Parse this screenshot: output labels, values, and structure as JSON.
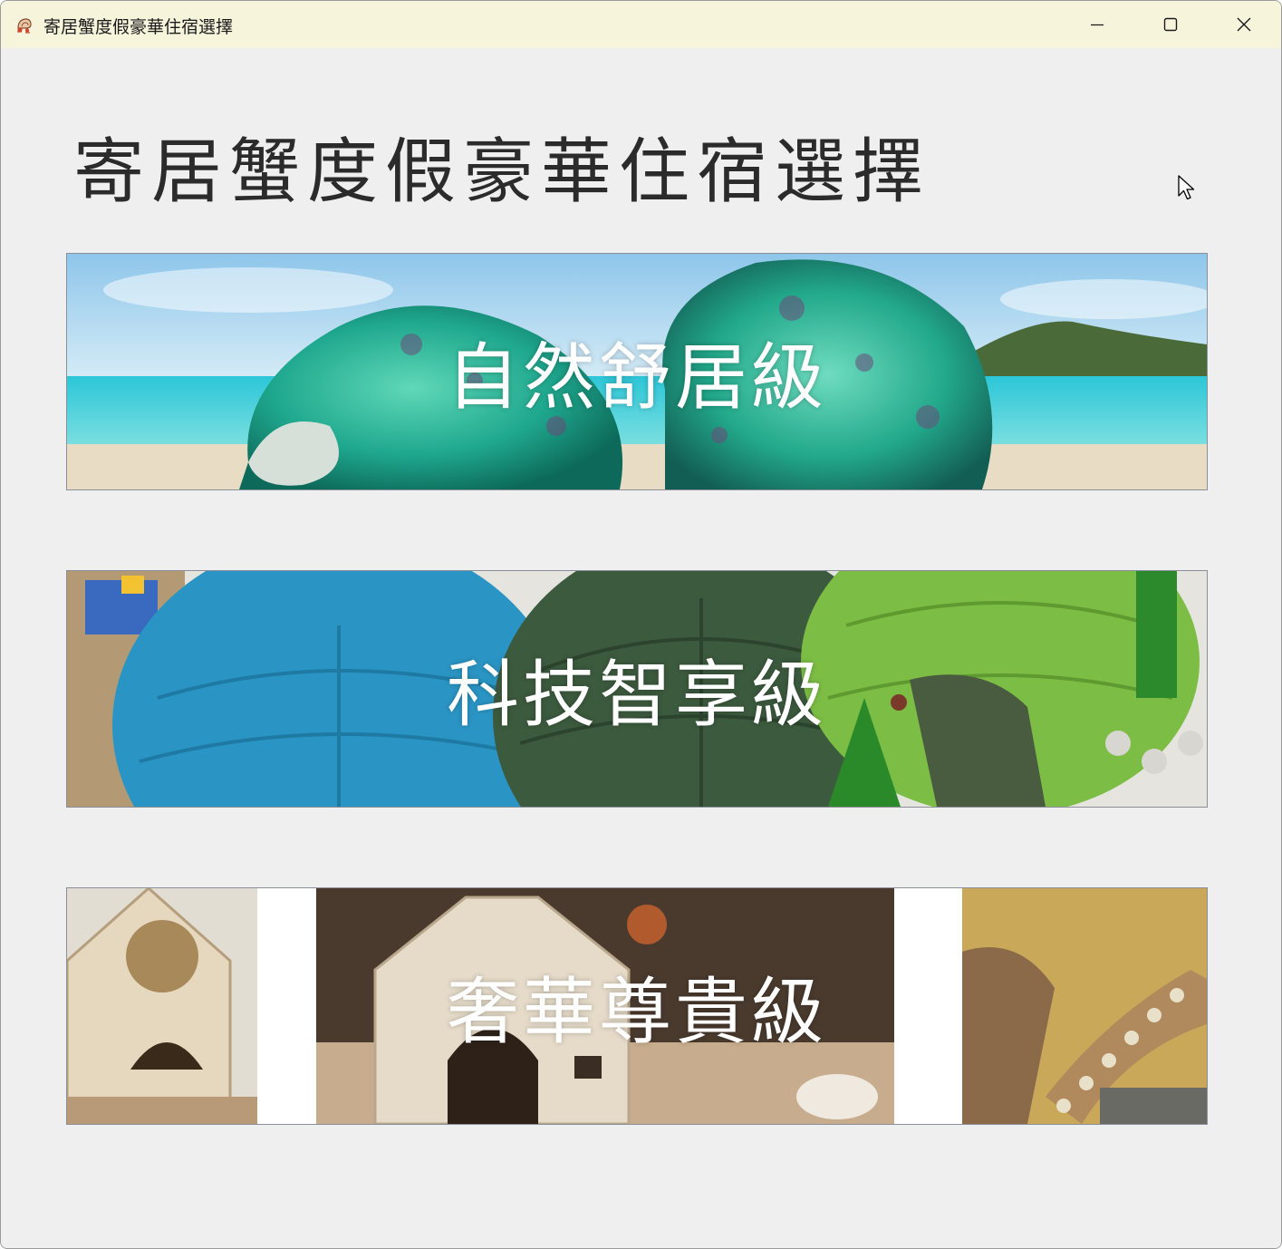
{
  "window": {
    "title": "寄居蟹度假豪華住宿選擇",
    "app_icon": "hermit-crab-icon",
    "controls": {
      "minimize_icon": "minimize-icon",
      "maximize_icon": "maximize-icon",
      "close_icon": "close-icon"
    }
  },
  "header": {
    "title": "寄居蟹度假豪華住宿選擇"
  },
  "tiers": [
    {
      "label": "自然舒居級",
      "image": "seashells-on-beach"
    },
    {
      "label": "科技智享級",
      "image": "3d-printed-turtle-shells"
    },
    {
      "label": "奢華尊貴級",
      "image": "wooden-crab-houses"
    }
  ],
  "colors": {
    "titlebar": "#f7f4dc",
    "background": "#efefef",
    "title_text": "#2b2b2b",
    "label_text": "#ffffff",
    "card_border": "#8a8f99"
  }
}
